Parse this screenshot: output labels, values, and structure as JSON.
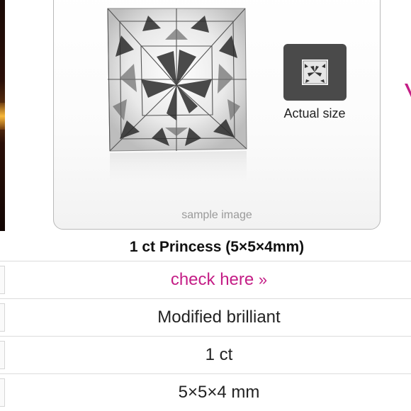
{
  "image_card": {
    "actual_size_label": "Actual size",
    "sample_label": "sample image"
  },
  "product": {
    "title": "1 ct Princess (5×5×4mm)"
  },
  "specs": {
    "check_link": "check here",
    "check_link_suffix": "»",
    "cut_style": "Modified brilliant",
    "carat": "1 ct",
    "dimensions": "5×5×4 mm"
  },
  "colors": {
    "accent": "#c41e86",
    "actual_size_box": "#4a4a4a"
  },
  "icons": [
    "diamond-image",
    "diamond-thumbnail",
    "next-arrow-icon"
  ]
}
